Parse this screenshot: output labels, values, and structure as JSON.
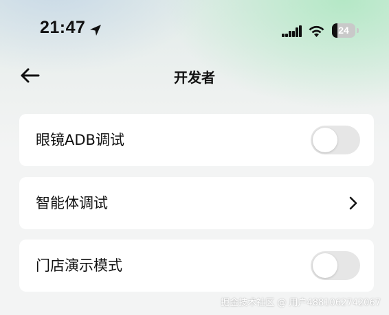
{
  "status_bar": {
    "time": "21:47",
    "battery_level": "24",
    "battery_fraction": 0.24,
    "icons": [
      "location-arrow-icon",
      "cellular-signal-icon",
      "wifi-icon",
      "battery-icon"
    ]
  },
  "nav": {
    "back_icon": "back-arrow-icon",
    "title": "开发者"
  },
  "settings": {
    "items": [
      {
        "label": "眼镜ADB调试",
        "control": "toggle",
        "on": false
      },
      {
        "label": "智能体调试",
        "control": "chevron",
        "icon": "chevron-right-icon"
      },
      {
        "label": "门店演示模式",
        "control": "toggle",
        "on": false
      }
    ]
  },
  "watermark": "掘金技术社区 @ 用户4881062742067",
  "colors": {
    "card_background": "#ffffff",
    "page_background": "#f3f4f4",
    "toggle_off": "#e6e6e6",
    "text_primary": "#111111"
  }
}
